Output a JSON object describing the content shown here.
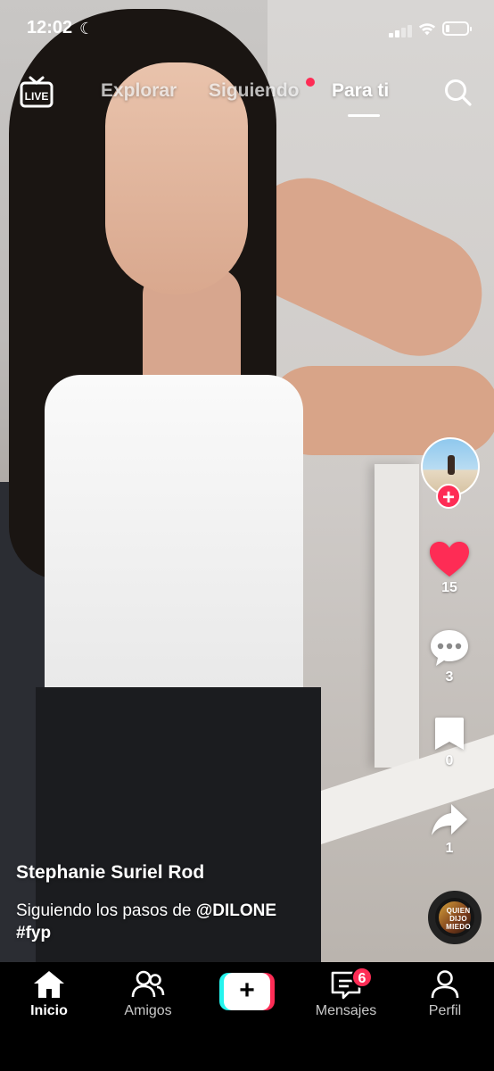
{
  "status_bar": {
    "time": "12:02",
    "moon_icon": "moon-icon",
    "battery_level": 0.15
  },
  "top_nav": {
    "live_label": "LIVE",
    "tabs": [
      {
        "label": "Explorar",
        "active": false
      },
      {
        "label": "Siguiendo",
        "active": false,
        "has_dot": true
      },
      {
        "label": "Para ti",
        "active": true
      }
    ]
  },
  "video": {
    "author": "Stephanie Suriel Rod",
    "description_prefix": "Siguiendo los pasos de ",
    "mention": "@DILONE",
    "hashtag": "#fyp"
  },
  "actions": {
    "likes": "15",
    "comments": "3",
    "saves": "0",
    "shares": "1",
    "liked": true
  },
  "music": {
    "cover_text": "QUIEN DIJO MIEDO"
  },
  "bottom_nav": {
    "items": [
      {
        "label": "Inicio",
        "icon": "home-icon",
        "active": true
      },
      {
        "label": "Amigos",
        "icon": "friends-icon"
      },
      {
        "label": "",
        "icon": "create-icon"
      },
      {
        "label": "Mensajes",
        "icon": "inbox-icon",
        "badge": "6"
      },
      {
        "label": "Perfil",
        "icon": "profile-icon"
      }
    ]
  },
  "colors": {
    "accent": "#fe2c55",
    "cyan": "#25f4ee",
    "background": "#000000"
  }
}
